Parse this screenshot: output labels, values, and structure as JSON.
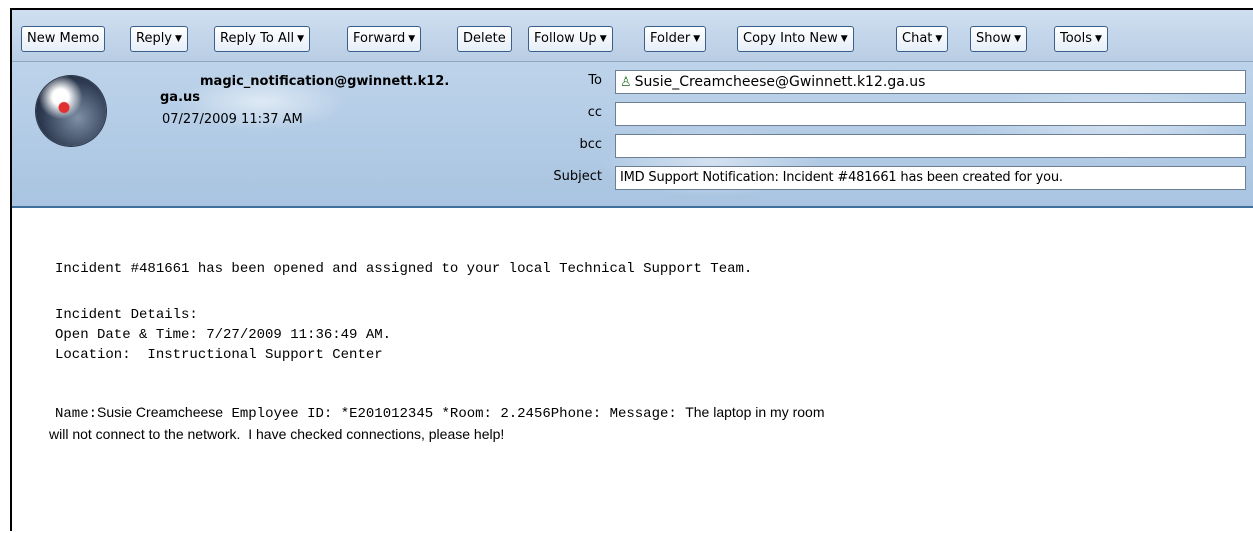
{
  "toolbar": {
    "buttons": [
      {
        "label": "New Memo",
        "dropdown": false
      },
      {
        "label": "Reply",
        "dropdown": true
      },
      {
        "label": "Reply To All",
        "dropdown": true
      },
      {
        "label": "Forward",
        "dropdown": true
      },
      {
        "label": "Delete",
        "dropdown": false
      },
      {
        "label": "Follow Up",
        "dropdown": true
      },
      {
        "label": "Folder",
        "dropdown": true
      },
      {
        "label": "Copy Into New",
        "dropdown": true
      },
      {
        "label": "Chat",
        "dropdown": true
      },
      {
        "label": "Show",
        "dropdown": true
      },
      {
        "label": "Tools",
        "dropdown": true
      }
    ],
    "caret": "▼"
  },
  "header": {
    "sender_line1": "magic_notification@gwinnett.k12.",
    "sender_line2": "ga.us",
    "date": "07/27/2009 11:37 AM",
    "to_label": "To",
    "cc_label": "cc",
    "bcc_label": "bcc",
    "subject_label": "Subject",
    "to_value": "Susie_Creamcheese@Gwinnett.k12.ga.us",
    "cc_value": "",
    "bcc_value": "",
    "subject_value": "IMD Support Notification:  Incident #481661 has been created for you.",
    "person_icon": "♙"
  },
  "body": {
    "line1": "Incident #481661 has been opened and assigned to your local Technical Support Team.",
    "details_heading": "Incident Details:",
    "open_date": "Open Date & Time: 7/27/2009 11:36:49 AM.",
    "location": "Location:  Instructional Support Center",
    "name_label": "Name:",
    "name_value": "Susie Creamcheese",
    "employee_id_label": " Employee ID: ",
    "employee_id_value": "*E201012345",
    "room_label": " *Room: ",
    "room_value": "2.2456",
    "phone_label": "Phone: ",
    "message_label": "Message: ",
    "message_line1": "The laptop in my room",
    "message_line2": "will not connect to the network.  I have checked connections, please help!"
  },
  "colors": {
    "toolbar_bg": "#c4d7ec",
    "header_bg": "#b3cbe5",
    "button_border": "#3a5f8c",
    "header_divider": "#3f6f9c"
  }
}
